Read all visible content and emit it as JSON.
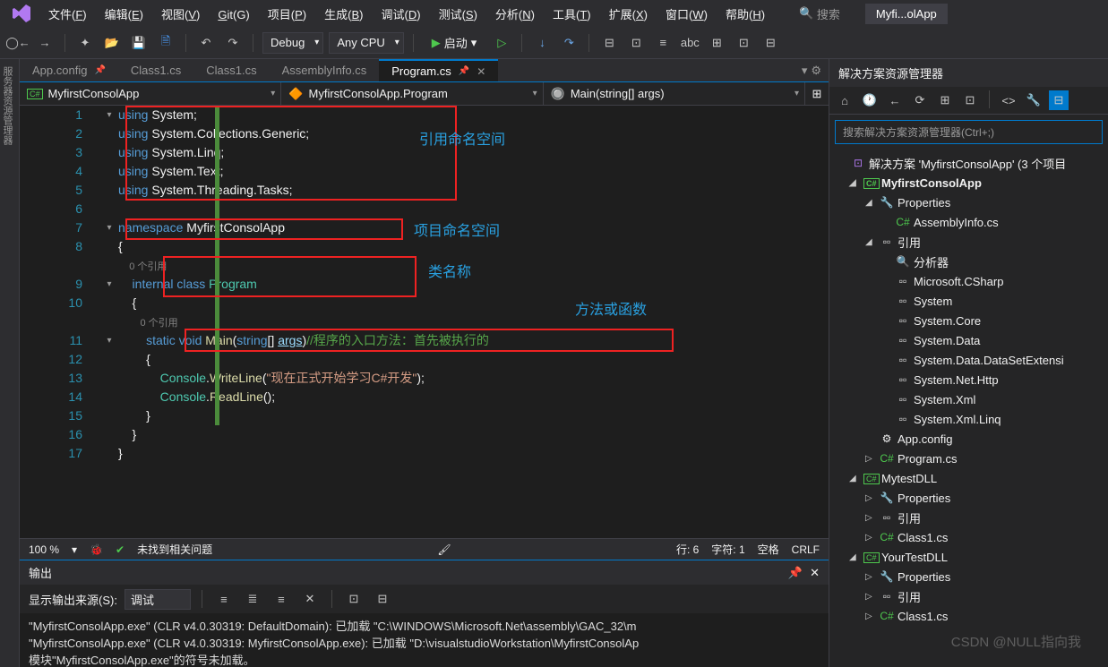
{
  "menubar": {
    "items": [
      {
        "label": "文件(F)",
        "key": "F"
      },
      {
        "label": "编辑(E)",
        "key": "E"
      },
      {
        "label": "视图(V)",
        "key": "V"
      },
      {
        "label": "Git(G)",
        "key": "G"
      },
      {
        "label": "项目(P)",
        "key": "P"
      },
      {
        "label": "生成(B)",
        "key": "B"
      },
      {
        "label": "调试(D)",
        "key": "D"
      },
      {
        "label": "测试(S)",
        "key": "S"
      },
      {
        "label": "分析(N)",
        "key": "N"
      },
      {
        "label": "工具(T)",
        "key": "T"
      },
      {
        "label": "扩展(X)",
        "key": "X"
      },
      {
        "label": "窗口(W)",
        "key": "W"
      },
      {
        "label": "帮助(H)",
        "key": "H"
      }
    ],
    "search_placeholder": "搜索",
    "app_title": "Myfi...olApp"
  },
  "toolbar": {
    "config": "Debug",
    "platform": "Any CPU",
    "start_label": "启动"
  },
  "left_tab": "服务器资源管理器",
  "doc_tabs": [
    {
      "label": "App.config",
      "pinned": true,
      "active": false
    },
    {
      "label": "Class1.cs",
      "active": false
    },
    {
      "label": "Class1.cs",
      "active": false
    },
    {
      "label": "AssemblyInfo.cs",
      "active": false
    },
    {
      "label": "Program.cs",
      "pinned": true,
      "active": true
    }
  ],
  "nav": {
    "project": "MyfirstConsolApp",
    "class": "MyfirstConsolApp.Program",
    "member": "Main(string[] args)"
  },
  "code": {
    "lines": [
      {
        "n": 1,
        "fold": "▾",
        "tokens": [
          {
            "t": "using ",
            "c": "kw"
          },
          {
            "t": "System;",
            "c": ""
          }
        ]
      },
      {
        "n": 2,
        "tokens": [
          {
            "t": "using ",
            "c": "kw"
          },
          {
            "t": "System.Collections.Generic;",
            "c": ""
          }
        ]
      },
      {
        "n": 3,
        "tokens": [
          {
            "t": "using ",
            "c": "kw"
          },
          {
            "t": "System.Linq;",
            "c": ""
          }
        ]
      },
      {
        "n": 4,
        "tokens": [
          {
            "t": "using ",
            "c": "kw"
          },
          {
            "t": "System.Text;",
            "c": ""
          }
        ]
      },
      {
        "n": 5,
        "tokens": [
          {
            "t": "using ",
            "c": "kw"
          },
          {
            "t": "System.Threading.Tasks;",
            "c": ""
          }
        ]
      },
      {
        "n": 6,
        "tokens": []
      },
      {
        "n": 7,
        "fold": "▾",
        "tokens": [
          {
            "t": "namespace ",
            "c": "kw"
          },
          {
            "t": "MyfirstConsolApp",
            "c": ""
          }
        ]
      },
      {
        "n": 8,
        "tokens": [
          {
            "t": "{",
            "c": ""
          }
        ]
      },
      {
        "n": "",
        "tokens": [
          {
            "t": "    0 个引用",
            "c": "codelens"
          }
        ]
      },
      {
        "n": 9,
        "fold": "▾",
        "tokens": [
          {
            "t": "    internal class ",
            "c": "kw"
          },
          {
            "t": "Program",
            "c": "type"
          }
        ]
      },
      {
        "n": 10,
        "tokens": [
          {
            "t": "    {",
            "c": ""
          }
        ]
      },
      {
        "n": "",
        "tokens": [
          {
            "t": "        0 个引用",
            "c": "codelens"
          }
        ]
      },
      {
        "n": 11,
        "fold": "▾",
        "tokens": [
          {
            "t": "        static void ",
            "c": "kw"
          },
          {
            "t": "Main",
            "c": "method"
          },
          {
            "t": "(",
            "c": ""
          },
          {
            "t": "string",
            "c": "kw"
          },
          {
            "t": "[] ",
            "c": ""
          },
          {
            "t": "args",
            "c": "param"
          },
          {
            "t": ")",
            "c": ""
          },
          {
            "t": "//程序的入口方法：首先被执行的",
            "c": "cmt"
          }
        ]
      },
      {
        "n": 12,
        "tokens": [
          {
            "t": "        {",
            "c": ""
          }
        ]
      },
      {
        "n": 13,
        "tokens": [
          {
            "t": "            Console",
            "c": "type"
          },
          {
            "t": ".",
            "c": ""
          },
          {
            "t": "WriteLine",
            "c": "method"
          },
          {
            "t": "(",
            "c": ""
          },
          {
            "t": "\"现在正式开始学习C#开发\"",
            "c": "str"
          },
          {
            "t": ");",
            "c": ""
          }
        ]
      },
      {
        "n": 14,
        "tokens": [
          {
            "t": "            Console",
            "c": "type"
          },
          {
            "t": ".",
            "c": ""
          },
          {
            "t": "ReadLine",
            "c": "method"
          },
          {
            "t": "();",
            "c": ""
          }
        ]
      },
      {
        "n": 15,
        "tokens": [
          {
            "t": "        }",
            "c": ""
          }
        ]
      },
      {
        "n": 16,
        "tokens": [
          {
            "t": "    }",
            "c": ""
          }
        ]
      },
      {
        "n": 17,
        "tokens": [
          {
            "t": "}",
            "c": ""
          }
        ]
      }
    ]
  },
  "annotations": {
    "a1": "引用命名空间",
    "a2": "项目命名空间",
    "a3": "类名称",
    "a4": "方法或函数"
  },
  "status": {
    "zoom": "100 %",
    "issues": "未找到相关问题",
    "line": "行: 6",
    "char": "字符: 1",
    "ins": "空格",
    "eol": "CRLF"
  },
  "output": {
    "title": "输出",
    "source_label": "显示输出来源(S):",
    "source_value": "调试",
    "lines": [
      "\"MyfirstConsolApp.exe\" (CLR v4.0.30319: DefaultDomain): 已加载 \"C:\\WINDOWS\\Microsoft.Net\\assembly\\GAC_32\\m",
      "\"MyfirstConsolApp.exe\" (CLR v4.0.30319: MyfirstConsolApp.exe): 已加载 \"D:\\visualstudioWorkstation\\MyfirstConsolAp",
      "模块\"MyfirstConsolApp.exe\"的符号未加载。"
    ]
  },
  "solution": {
    "title": "解决方案资源管理器",
    "search_placeholder": "搜索解决方案资源管理器(Ctrl+;)",
    "root": "解决方案 'MyfirstConsolApp' (3 个项目",
    "tree": [
      {
        "label": "MyfirstConsolApp",
        "ind": 1,
        "icon": "proj",
        "exp": "◢",
        "bold": true
      },
      {
        "label": "Properties",
        "ind": 2,
        "icon": "wrench",
        "exp": "◢"
      },
      {
        "label": "AssemblyInfo.cs",
        "ind": 3,
        "icon": "cs"
      },
      {
        "label": "引用",
        "ind": 2,
        "icon": "ref",
        "exp": "◢"
      },
      {
        "label": "分析器",
        "ind": 3,
        "icon": "anal"
      },
      {
        "label": "Microsoft.CSharp",
        "ind": 3,
        "icon": "ref"
      },
      {
        "label": "System",
        "ind": 3,
        "icon": "ref"
      },
      {
        "label": "System.Core",
        "ind": 3,
        "icon": "ref"
      },
      {
        "label": "System.Data",
        "ind": 3,
        "icon": "ref"
      },
      {
        "label": "System.Data.DataSetExtensi",
        "ind": 3,
        "icon": "ref"
      },
      {
        "label": "System.Net.Http",
        "ind": 3,
        "icon": "ref"
      },
      {
        "label": "System.Xml",
        "ind": 3,
        "icon": "ref"
      },
      {
        "label": "System.Xml.Linq",
        "ind": 3,
        "icon": "ref"
      },
      {
        "label": "App.config",
        "ind": 2,
        "icon": "cfg"
      },
      {
        "label": "Program.cs",
        "ind": 2,
        "icon": "cs",
        "exp": "▷"
      },
      {
        "label": "MytestDLL",
        "ind": 1,
        "icon": "proj",
        "exp": "◢"
      },
      {
        "label": "Properties",
        "ind": 2,
        "icon": "wrench",
        "exp": "▷"
      },
      {
        "label": "引用",
        "ind": 2,
        "icon": "ref",
        "exp": "▷"
      },
      {
        "label": "Class1.cs",
        "ind": 2,
        "icon": "cs",
        "exp": "▷"
      },
      {
        "label": "YourTestDLL",
        "ind": 1,
        "icon": "proj",
        "exp": "◢"
      },
      {
        "label": "Properties",
        "ind": 2,
        "icon": "wrench",
        "exp": "▷"
      },
      {
        "label": "引用",
        "ind": 2,
        "icon": "ref",
        "exp": "▷"
      },
      {
        "label": "Class1.cs",
        "ind": 2,
        "icon": "cs",
        "exp": "▷"
      }
    ]
  },
  "watermark": "CSDN @NULL指向我"
}
